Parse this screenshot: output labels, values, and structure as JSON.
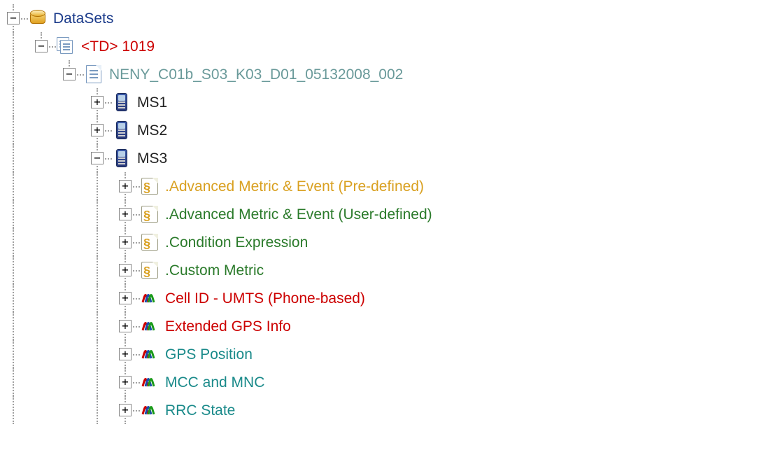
{
  "tree": {
    "root": "DataSets",
    "td": "<TD> 1019",
    "file": "NENY_C01b_S03_K03_D01_05132008_002",
    "ms": [
      "MS1",
      "MS2",
      "MS3"
    ],
    "ms3_children": [
      {
        "label": ".Advanced Metric & Event (Pre-defined)",
        "color": "orange",
        "icon": "script"
      },
      {
        "label": ".Advanced Metric & Event (User-defined)",
        "color": "green",
        "icon": "script"
      },
      {
        "label": ".Condition Expression",
        "color": "green",
        "icon": "script"
      },
      {
        "label": ".Custom Metric",
        "color": "green",
        "icon": "script"
      },
      {
        "label": "Cell ID - UMTS (Phone-based)",
        "color": "red",
        "icon": "sig"
      },
      {
        "label": "Extended GPS Info",
        "color": "red",
        "icon": "sig"
      },
      {
        "label": "GPS Position",
        "color": "teal",
        "icon": "sig"
      },
      {
        "label": "MCC and MNC",
        "color": "teal",
        "icon": "sig"
      },
      {
        "label": "RRC State",
        "color": "teal",
        "icon": "sig"
      }
    ]
  }
}
